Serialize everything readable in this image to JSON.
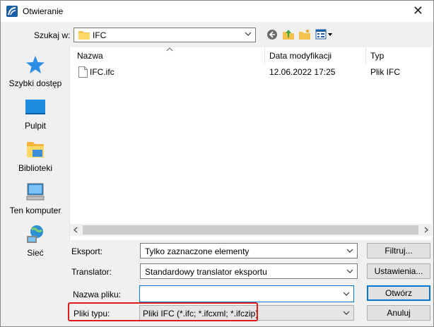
{
  "window": {
    "title": "Otwieranie",
    "close_glyph": "✕"
  },
  "toolbar": {
    "lookin_label": "Szukaj w:",
    "lookin_value": "IFC",
    "icons": [
      "back-icon",
      "up-folder-icon",
      "new-folder-icon",
      "view-menu-icon"
    ]
  },
  "places": [
    {
      "label": "Szybki dostęp",
      "icon": "star-icon"
    },
    {
      "label": "Pulpit",
      "icon": "desktop-icon"
    },
    {
      "label": "Biblioteki",
      "icon": "libraries-icon"
    },
    {
      "label": "Ten komputer",
      "icon": "computer-icon"
    },
    {
      "label": "Sieć",
      "icon": "network-icon"
    }
  ],
  "filelist": {
    "columns": [
      "Nazwa",
      "Data modyfikacji",
      "Typ"
    ],
    "rows": [
      {
        "name": "IFC.ifc",
        "date": "12.06.2022 17:25",
        "type": "Plik IFC"
      }
    ]
  },
  "options": {
    "export_label": "Eksport:",
    "export_value": "Tylko zaznaczone elementy",
    "filter_button": "Filtruj...",
    "translator_label": "Translator:",
    "translator_value": "Standardowy translator eksportu",
    "settings_button": "Ustawienia...",
    "filename_label": "Nazwa pliku:",
    "filename_value": "",
    "open_button": "Otwórz",
    "filetype_label": "Pliki typu:",
    "filetype_value": "Pliki IFC (*.ifc; *.ifcxml; *.ifczip)",
    "cancel_button": "Anuluj"
  },
  "colors": {
    "accent": "#0078d7",
    "highlight_border": "#e01b1b"
  }
}
